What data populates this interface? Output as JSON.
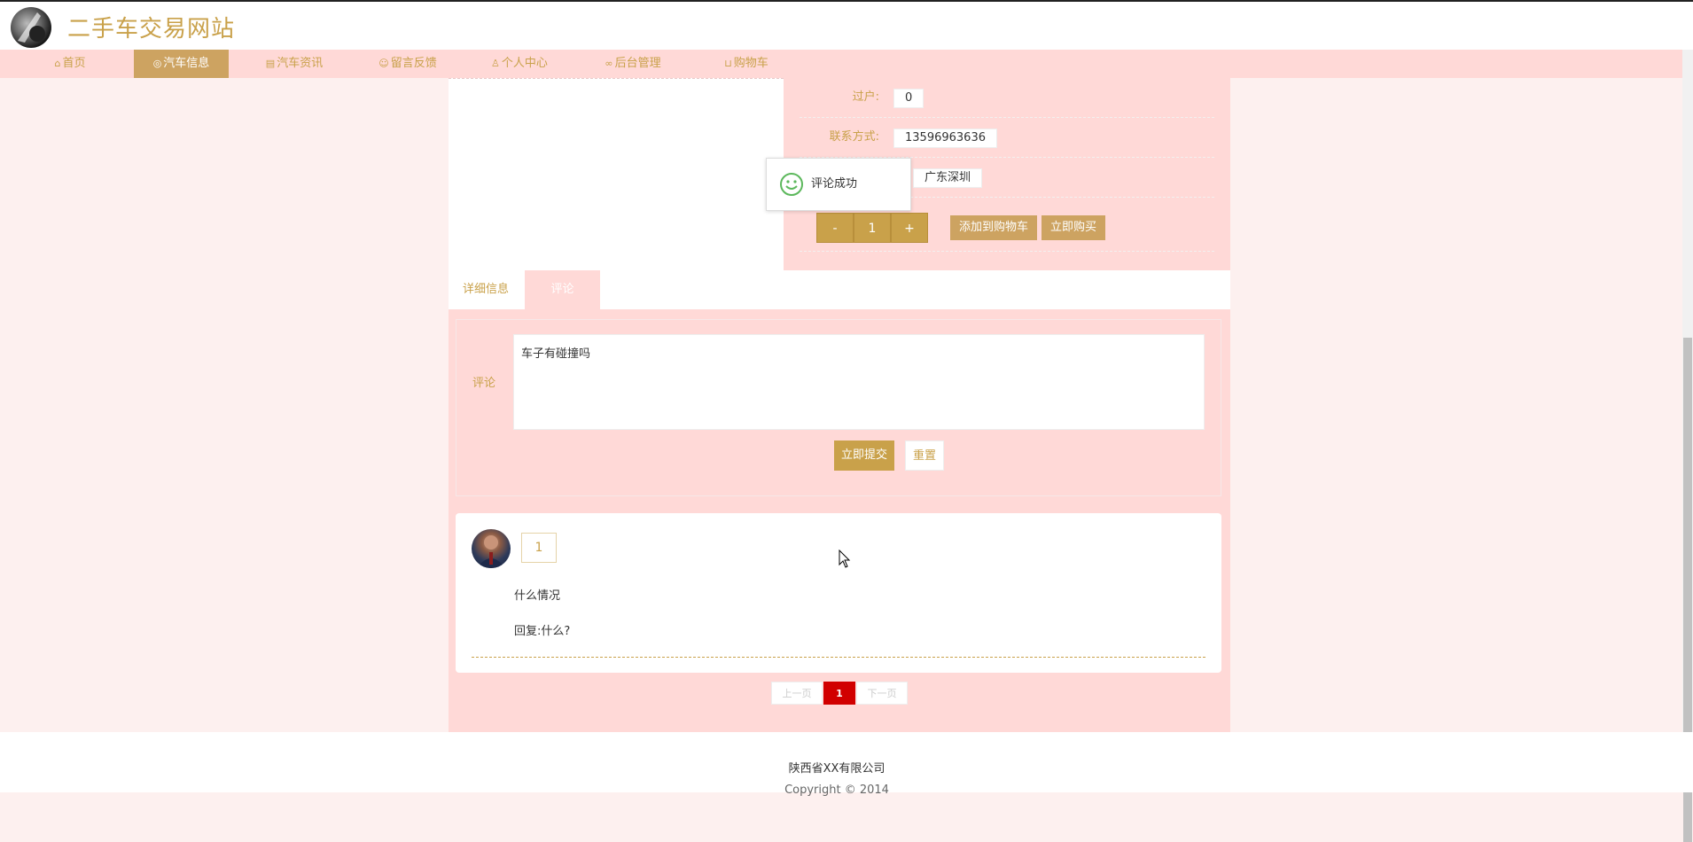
{
  "site": {
    "title": "二手车交易网站"
  },
  "nav": [
    {
      "label": "首页",
      "icon": "home-icon",
      "active": false
    },
    {
      "label": "汽车信息",
      "icon": "target-icon",
      "active": true
    },
    {
      "label": "汽车资讯",
      "icon": "news-icon",
      "active": false
    },
    {
      "label": "留言反馈",
      "icon": "smile-icon",
      "active": false
    },
    {
      "label": "个人中心",
      "icon": "user-icon",
      "active": false
    },
    {
      "label": "后台管理",
      "icon": "link-icon",
      "active": false
    },
    {
      "label": "购物车",
      "icon": "cart-icon",
      "active": false
    }
  ],
  "product": {
    "rows": [
      {
        "label": "过户:",
        "value": "0"
      },
      {
        "label": "联系方式:",
        "value": "13596963636"
      },
      {
        "label": "",
        "value": "广东深圳"
      }
    ],
    "quantity": {
      "minus": "-",
      "value": "1",
      "plus": "+"
    },
    "add_to_cart": "添加到购物车",
    "buy_now": "立即购买"
  },
  "toast": {
    "text": "评论成功",
    "icon": "smile-face-icon"
  },
  "tabs": [
    {
      "label": "详细信息"
    },
    {
      "label": "评论"
    }
  ],
  "comment_form": {
    "label": "评论",
    "value": "车子有碰撞吗",
    "submit": "立即提交",
    "reset": "重置"
  },
  "comments": [
    {
      "user": "1",
      "text": "什么情况",
      "reply": "回复:什么?"
    }
  ],
  "pagination": {
    "prev": "上一页",
    "current": "1",
    "next": "下一页"
  },
  "footer": {
    "company": "陕西省XX有限公司",
    "copyright": "Copyright © 2014"
  },
  "colors": {
    "accent": "#c9a14a",
    "nav_bg": "#ffd9d7",
    "active_nav": "#cda361",
    "page_current": "#d10000"
  }
}
